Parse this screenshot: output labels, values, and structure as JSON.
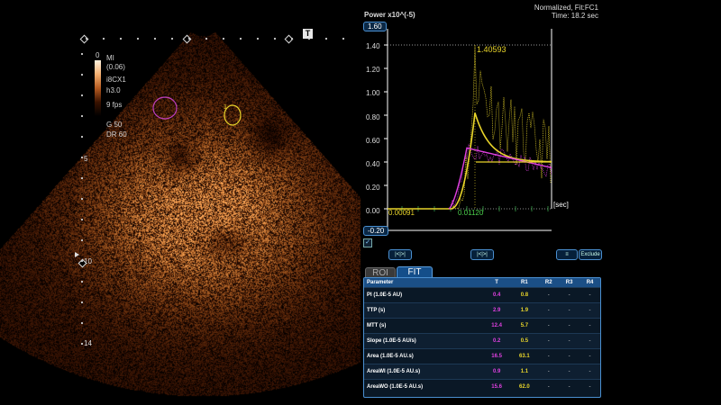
{
  "header": {
    "mode": "Normalized, Fit:FC1",
    "time": "Time: 18.2 sec"
  },
  "image_legend": {
    "mi_label": "MI",
    "mi_value": "(0.06)",
    "probe": "i8CX1",
    "harmonic": "h3.0",
    "fps": "9 fps",
    "gain": "G 50",
    "dr": "DR 60",
    "scale_top": "0"
  },
  "depth_ticks": [
    "5",
    "10",
    "14"
  ],
  "roi_labels": {
    "yellow": "1"
  },
  "graph": {
    "y_axis_label": "Power x10^(-5)",
    "x_axis_label": "[sec]",
    "y_top": "1.60",
    "y_bottom": "-0.20",
    "y_ticks": [
      "1.40",
      "1.20",
      "1.00",
      "0.80",
      "0.60",
      "0.40",
      "0.20",
      "0.00"
    ],
    "annotations": {
      "peak": "1.40593",
      "baseline_yellow": "0.00091",
      "arrival": "0.01120"
    },
    "colors": {
      "T": "#e040e0",
      "R1": "#e8d42a"
    }
  },
  "controls": {
    "btn1": "|<|>|",
    "btn2": "|<|>|",
    "btn3": "≡",
    "exclude": "Exclude"
  },
  "tabs": [
    "ROI",
    "FIT"
  ],
  "table": {
    "headers": [
      "Parameter",
      "T",
      "R1",
      "R2",
      "R3",
      "R4"
    ],
    "rows": [
      [
        "PI (1.0E-5 AU)",
        "0.4",
        "0.8",
        "-",
        "-",
        "-"
      ],
      [
        "TTP (s)",
        "2.9",
        "1.9",
        "-",
        "-",
        "-"
      ],
      [
        "MTT (s)",
        "12.4",
        "5.7",
        "-",
        "-",
        "-"
      ],
      [
        "Slope (1.0E-5 AU/s)",
        "0.2",
        "0.5",
        "-",
        "-",
        "-"
      ],
      [
        "Area (1.0E-5 AU.s)",
        "16.5",
        "63.1",
        "-",
        "-",
        "-"
      ],
      [
        "AreaWI (1.0E-5 AU.s)",
        "0.9",
        "1.1",
        "-",
        "-",
        "-"
      ],
      [
        "AreaWO (1.0E-5 AU.s)",
        "15.6",
        "62.0",
        "-",
        "-",
        "-"
      ]
    ]
  }
}
